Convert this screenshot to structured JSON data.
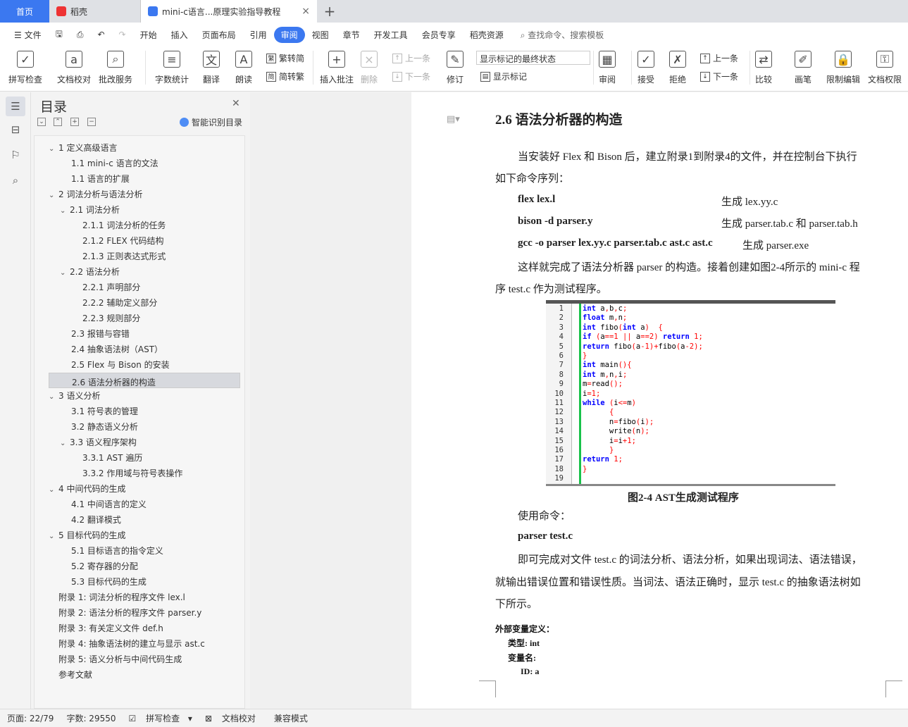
{
  "tabs": {
    "home": "首页",
    "dk": "稻壳",
    "doc": "mini-c语言...原理实验指导教程"
  },
  "menu": {
    "file": "文件",
    "items": [
      "开始",
      "插入",
      "页面布局",
      "引用",
      "审阅",
      "视图",
      "章节",
      "开发工具",
      "会员专享",
      "稻壳资源"
    ],
    "active": "审阅",
    "search": "查找命令、搜索模板"
  },
  "toolbar": {
    "spell": "拼写检查",
    "proof": "文档校对",
    "batch": "批改服务",
    "count": "字数统计",
    "translate": "翻译",
    "read": "朗读",
    "t2s": "繁转简",
    "s2t": "简转繁",
    "comment": "插入批注",
    "delete": "删除",
    "prev1": "上一条",
    "next1": "下一条",
    "track": "修订",
    "markup_state": "显示标记的最终状态",
    "show_markup": "显示标记",
    "review": "审阅",
    "accept": "接受",
    "reject": "拒绝",
    "prev2": "上一条",
    "next2": "下一条",
    "compare": "比较",
    "pen": "画笔",
    "restrict": "限制编辑",
    "rights": "文档权限"
  },
  "toc": {
    "title": "目录",
    "ai": "智能识别目录",
    "items": [
      {
        "t": "1 定义高级语言",
        "lv": 1,
        "ex": true
      },
      {
        "t": "1.1 mini-c 语言的文法",
        "lv": 2
      },
      {
        "t": "1.1 语言的扩展",
        "lv": 2
      },
      {
        "t": "2 词法分析与语法分析",
        "lv": 1,
        "ex": true
      },
      {
        "t": "2.1  词法分析",
        "lv": 2,
        "ex": true
      },
      {
        "t": "2.1.1  词法分析的任务",
        "lv": 3
      },
      {
        "t": "2.1.2 FLEX 代码结构",
        "lv": 3
      },
      {
        "t": "2.1.3  正则表达式形式",
        "lv": 3
      },
      {
        "t": "2.2  语法分析",
        "lv": 2,
        "ex": true
      },
      {
        "t": "2.2.1  声明部分",
        "lv": 3
      },
      {
        "t": "2.2.2  辅助定义部分",
        "lv": 3
      },
      {
        "t": "2.2.3  规则部分",
        "lv": 3
      },
      {
        "t": "2.3  报错与容错",
        "lv": 2
      },
      {
        "t": "2.4  抽象语法树（AST）",
        "lv": 2
      },
      {
        "t": "2.5 Flex 与 Bison 的安装",
        "lv": 2
      },
      {
        "t": "2.6 语法分析器的构造",
        "lv": 2,
        "sel": true
      },
      {
        "t": "3 语义分析",
        "lv": 1,
        "ex": true
      },
      {
        "t": "3.1  符号表的管理",
        "lv": 2
      },
      {
        "t": "3.2  静态语义分析",
        "lv": 2
      },
      {
        "t": "3.3  语义程序架构",
        "lv": 2,
        "ex": true
      },
      {
        "t": "3.3.1 AST 遍历",
        "lv": 3
      },
      {
        "t": "3.3.2  作用域与符号表操作",
        "lv": 3
      },
      {
        "t": "4 中间代码的生成",
        "lv": 1,
        "ex": true
      },
      {
        "t": "4.1  中间语言的定义",
        "lv": 2
      },
      {
        "t": "4.2  翻译模式",
        "lv": 2
      },
      {
        "t": "5 目标代码的生成",
        "lv": 1,
        "ex": true
      },
      {
        "t": "5.1  目标语言的指令定义",
        "lv": 2
      },
      {
        "t": "5.2  寄存器的分配",
        "lv": 2
      },
      {
        "t": "5.3  目标代码的生成",
        "lv": 2
      },
      {
        "t": "附录 1:   词法分析的程序文件 lex.l",
        "lv": 1
      },
      {
        "t": "附录 2:   语法分析的程序文件 parser.y",
        "lv": 1
      },
      {
        "t": "附录 3:   有关定义文件 def.h",
        "lv": 1
      },
      {
        "t": "附录 4:   抽象语法树的建立与显示 ast.c",
        "lv": 1
      },
      {
        "t": "附录 5:   语义分析与中间代码生成",
        "lv": 1
      },
      {
        "t": "参考文献",
        "lv": 1
      }
    ]
  },
  "doc": {
    "heading": "2.6 语法分析器的构造",
    "p1a": "当安装好 Flex 和 Bison 后，建立附录1到附录4的文件，并在控制台下执行",
    "p1b": "如下命令序列：",
    "cmd1": "flex lex.l",
    "res1": "生成 lex.yy.c",
    "cmd2": "bison -d parser.y",
    "res2": "生成 parser.tab.c 和  parser.tab.h",
    "cmd3": "gcc -o parser lex.yy.c parser.tab.c ast.c ast.c",
    "res3": "生成  parser.exe",
    "p2a": "这样就完成了语法分析器 parser 的构造。接着创建如图2-4所示的 mini-c 程",
    "p2b": "序 test.c 作为测试程序。",
    "caption": "图2-4    AST生成测试程序",
    "p3": "使用命令：",
    "cmd4": "parser test.c",
    "p4a": "即可完成对文件 test.c 的词法分析、语法分析，如果出现词法、语法错误，",
    "p4b": "就输出错误位置和错误性质。当词法、语法正确时，显示 test.c 的抽象语法树如",
    "p4c": "下所示。",
    "t1": "外部变量定义：",
    "t2": "类型:   int",
    "t3": "变量名:",
    "t4": "ID:    a"
  },
  "code": [
    "int a,b,c;",
    "float m,n;",
    "int fibo(int a)  {",
    "if (a==1 || a==2) return 1;",
    "return fibo(a-1)+fibo(a-2);",
    "}",
    "int main(){",
    "int m,n,i;",
    "m=read();",
    "i=1;",
    "while (i<=m)",
    "      {",
    "      n=fibo(i);",
    "      write(n);",
    "      i=i+1;",
    "      }",
    "return 1;",
    "}",
    ""
  ],
  "status": {
    "page": "页面: 22/79",
    "words": "字数: 29550",
    "spell": "拼写检查",
    "proof": "文档校对",
    "compat": "兼容模式"
  }
}
